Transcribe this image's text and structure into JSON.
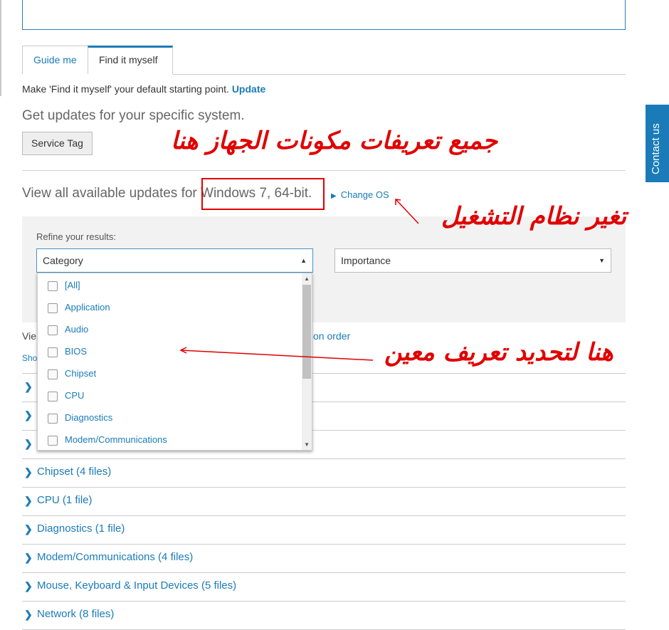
{
  "tabs": [
    {
      "label": "Guide me"
    },
    {
      "label": "Find it myself"
    }
  ],
  "make_default": {
    "text": "Make 'Find it myself' your default starting point.",
    "link": "Update"
  },
  "get_updates": "Get updates for your specific system.",
  "service_tag_button": "Service Tag",
  "view_all": {
    "prefix": "View all available updates for ",
    "os": "Windows 7, 64-bit.",
    "change_os": "Change OS"
  },
  "contact_us": "Contact us",
  "refine": {
    "label": "Refine your results:",
    "category_placeholder": "Category",
    "importance_placeholder": "Importance",
    "options": [
      "[All]",
      "Application",
      "Audio",
      "BIOS",
      "Chipset",
      "CPU",
      "Diagnostics",
      "Modem/Communications"
    ]
  },
  "behind_text": {
    "view": "Vie",
    "show": "Sho",
    "order": "on order"
  },
  "categories": [
    {
      "label": "Chipset (4 files)"
    },
    {
      "label": "CPU (1 file)"
    },
    {
      "label": "Diagnostics (1 file)"
    },
    {
      "label": "Modem/Communications (4 files)"
    },
    {
      "label": "Mouse, Keyboard & Input Devices (5 files)"
    },
    {
      "label": "Network (8 files)"
    }
  ],
  "annotations": {
    "all_drivers": "جميع تعريفات مكونات الجهاز هنا",
    "change_os": "تغير نظام التشغيل",
    "select_driver": "هنا لتحديد تعريف معين"
  },
  "colors": {
    "accent": "#1a7bb8",
    "annotation": "#e00000"
  }
}
